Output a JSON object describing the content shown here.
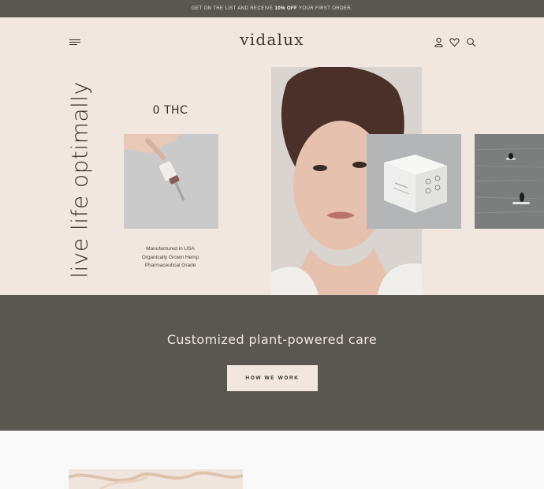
{
  "announcement": {
    "prefix": "GET ON THE LIST AND RECEIVE",
    "highlight": "10% OFF",
    "suffix": "YOUR FIRST ORDER."
  },
  "header": {
    "logo": "vidalux",
    "icons": [
      "user-icon",
      "heart-icon",
      "search-icon"
    ]
  },
  "hero": {
    "vertical_title": "live life optimally",
    "product_label": "0 THC",
    "features": [
      "Manufactured in USA",
      "Organically Grown Hemp",
      "Pharmaceutical Grade"
    ]
  },
  "band": {
    "title": "Customized plant-powered care",
    "button_label": "HOW WE WORK"
  },
  "colors": {
    "accent_dark": "#5a5650",
    "cream": "#f1e7de"
  }
}
